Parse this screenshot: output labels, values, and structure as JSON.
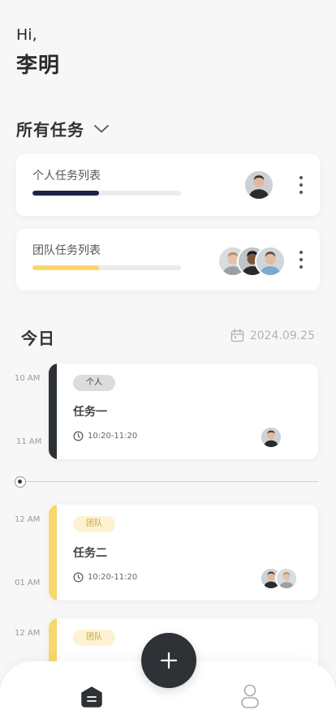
{
  "header": {
    "greeting": "Hi,",
    "name": "李明"
  },
  "task_lists": {
    "title": "所有任务",
    "items": [
      {
        "label": "个人任务列表",
        "progress": 0.45,
        "color": "#1f2247"
      },
      {
        "label": "团队任务列表",
        "progress": 0.45,
        "color": "#fad76a"
      }
    ]
  },
  "today": {
    "title": "今日",
    "date": "2024.09.25",
    "tasks": [
      {
        "tag": "个人",
        "title": "任务一",
        "time": "10:20-11:20",
        "start_label": "10 AM",
        "end_label": "11 AM",
        "accent": "#2d3035",
        "tag_bg": "#dcdcdc",
        "tag_color": "#444"
      },
      {
        "tag": "团队",
        "title": "任务二",
        "time": "10:20-11:20",
        "start_label": "12 AM",
        "end_label": "01 AM",
        "accent": "#f8d76b",
        "tag_bg": "#fdf3d3",
        "tag_color": "#c9a33b"
      },
      {
        "tag": "团队",
        "start_label": "12 AM",
        "accent": "#f8d76b",
        "tag_bg": "#fdf3d3",
        "tag_color": "#c9a33b"
      }
    ]
  },
  "nav": {
    "home_icon": "home-icon",
    "profile_icon": "profile-icon",
    "add_icon": "plus-icon"
  }
}
